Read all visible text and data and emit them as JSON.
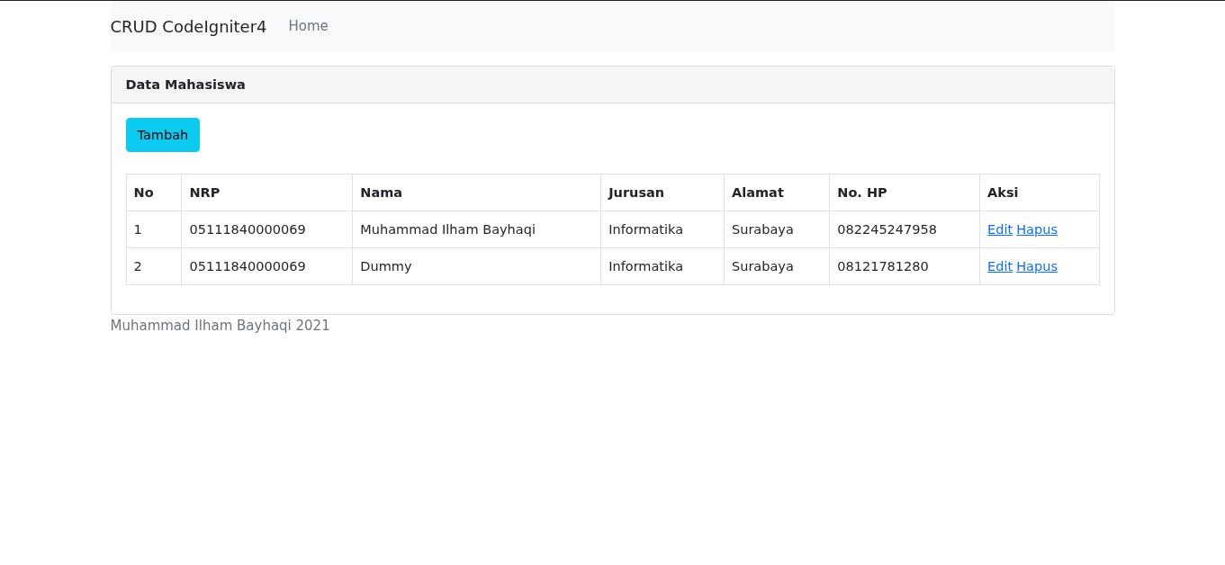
{
  "navbar": {
    "brand": "CRUD CodeIgniter4",
    "links": [
      {
        "label": "Home"
      }
    ]
  },
  "card": {
    "title": "Data Mahasiswa",
    "add_button": "Tambah",
    "table": {
      "columns": [
        "No",
        "NRP",
        "Nama",
        "Jurusan",
        "Alamat",
        "No. HP",
        "Aksi"
      ],
      "rows": [
        {
          "cells": [
            "1",
            "05111840000069",
            "Muhammad Ilham Bayhaqi",
            "Informatika",
            "Surabaya",
            "082245247958"
          ],
          "actions": [
            "Edit",
            "Hapus"
          ]
        },
        {
          "cells": [
            "2",
            "05111840000069",
            "Dummy",
            "Informatika",
            "Surabaya",
            "08121781280"
          ],
          "actions": [
            "Edit",
            "Hapus"
          ]
        }
      ]
    }
  },
  "footer": "Muhammad Ilham Bayhaqi 2021"
}
